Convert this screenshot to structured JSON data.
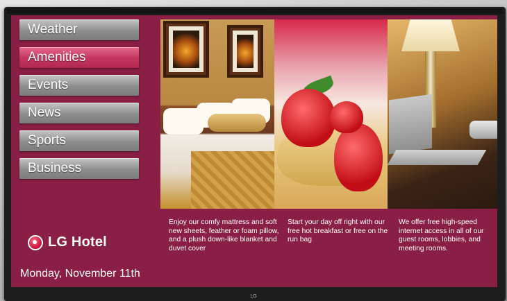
{
  "menu": {
    "items": [
      {
        "label": "Weather"
      },
      {
        "label": "Amenities",
        "active": true
      },
      {
        "label": "Events"
      },
      {
        "label": "News"
      },
      {
        "label": "Sports"
      },
      {
        "label": "Business"
      }
    ]
  },
  "brand": {
    "logo_text": "LG Hotel",
    "tv_brand": "LG"
  },
  "date": "Monday, November 11th",
  "panels": [
    {
      "image": "hotel-bed-photo",
      "caption": "Enjoy our comfy mattress and soft new sheets, feather or foam pillow, and a plush down-like blanket and duvet cover"
    },
    {
      "image": "breakfast-strawberry-crepe-photo",
      "caption": "Start your day off right with our free hot breakfast or free on the run bag"
    },
    {
      "image": "desk-lamp-laptop-photo",
      "caption": "We offer free high-speed internet access in all of our guest rooms, lobbies, and meeting rooms."
    }
  ],
  "colors": {
    "background": "#8a1f45",
    "active_menu": "#c63860",
    "menu_item": "#9a9a9a",
    "text": "#ffffff"
  }
}
